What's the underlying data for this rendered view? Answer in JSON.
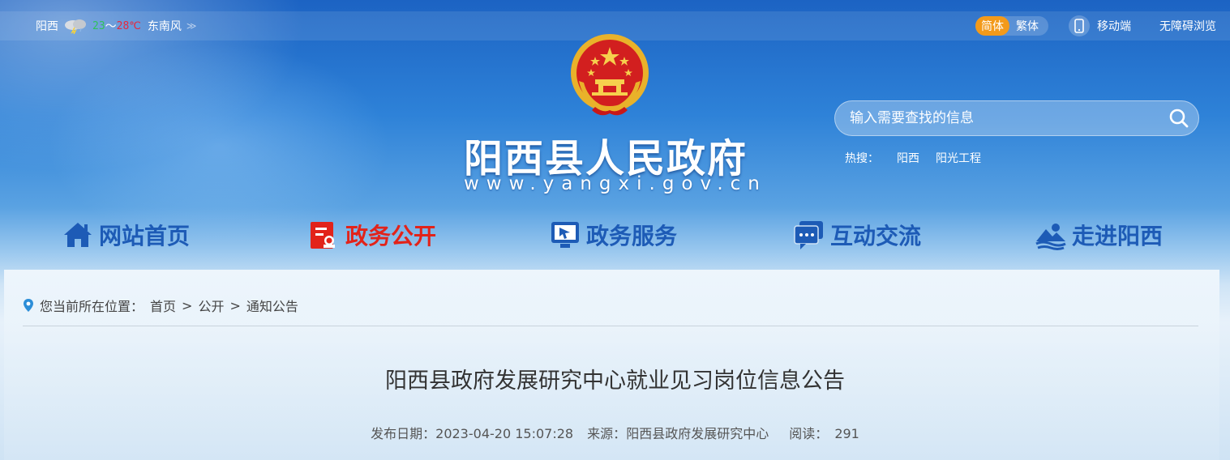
{
  "topbar": {
    "weather": {
      "city": "阳西",
      "icon": "thunderstorm-cloud-icon",
      "temp_low": "23",
      "temp_sep": "～",
      "temp_high": "28℃",
      "wind": "东南风",
      "more": "≫"
    },
    "lang": {
      "simplified": "简体",
      "traditional": "繁体"
    },
    "mobile": "移动端",
    "accessibility": "无障碍浏览"
  },
  "header": {
    "title": "阳西县人民政府",
    "url": "www.yangxi.gov.cn"
  },
  "search": {
    "placeholder": "输入需要查找的信息",
    "hot_label": "热搜：",
    "hot_items": [
      "阳西",
      "阳光工程"
    ]
  },
  "nav": {
    "items": [
      {
        "label": "网站首页",
        "icon": "home-icon"
      },
      {
        "label": "政务公开",
        "icon": "document-icon"
      },
      {
        "label": "政务服务",
        "icon": "service-screen-icon"
      },
      {
        "label": "互动交流",
        "icon": "chat-icon"
      },
      {
        "label": "走进阳西",
        "icon": "landscape-icon"
      }
    ],
    "active_index": 1
  },
  "breadcrumb": {
    "prefix": "您当前所在位置：",
    "items": [
      "首页",
      "公开",
      "通知公告"
    ],
    "separator": ">"
  },
  "article": {
    "title": "阳西县政府发展研究中心就业见习岗位信息公告",
    "date_label": "发布日期：",
    "date": "2023-04-20 15:07:28",
    "source_label": "来源：",
    "source": "阳西县政府发展研究中心",
    "views_label": "阅读：",
    "views": "291"
  },
  "colors": {
    "accent_blue": "#1d5bb6",
    "active_red": "#e2231a",
    "lang_orange": "#f39a1a"
  }
}
